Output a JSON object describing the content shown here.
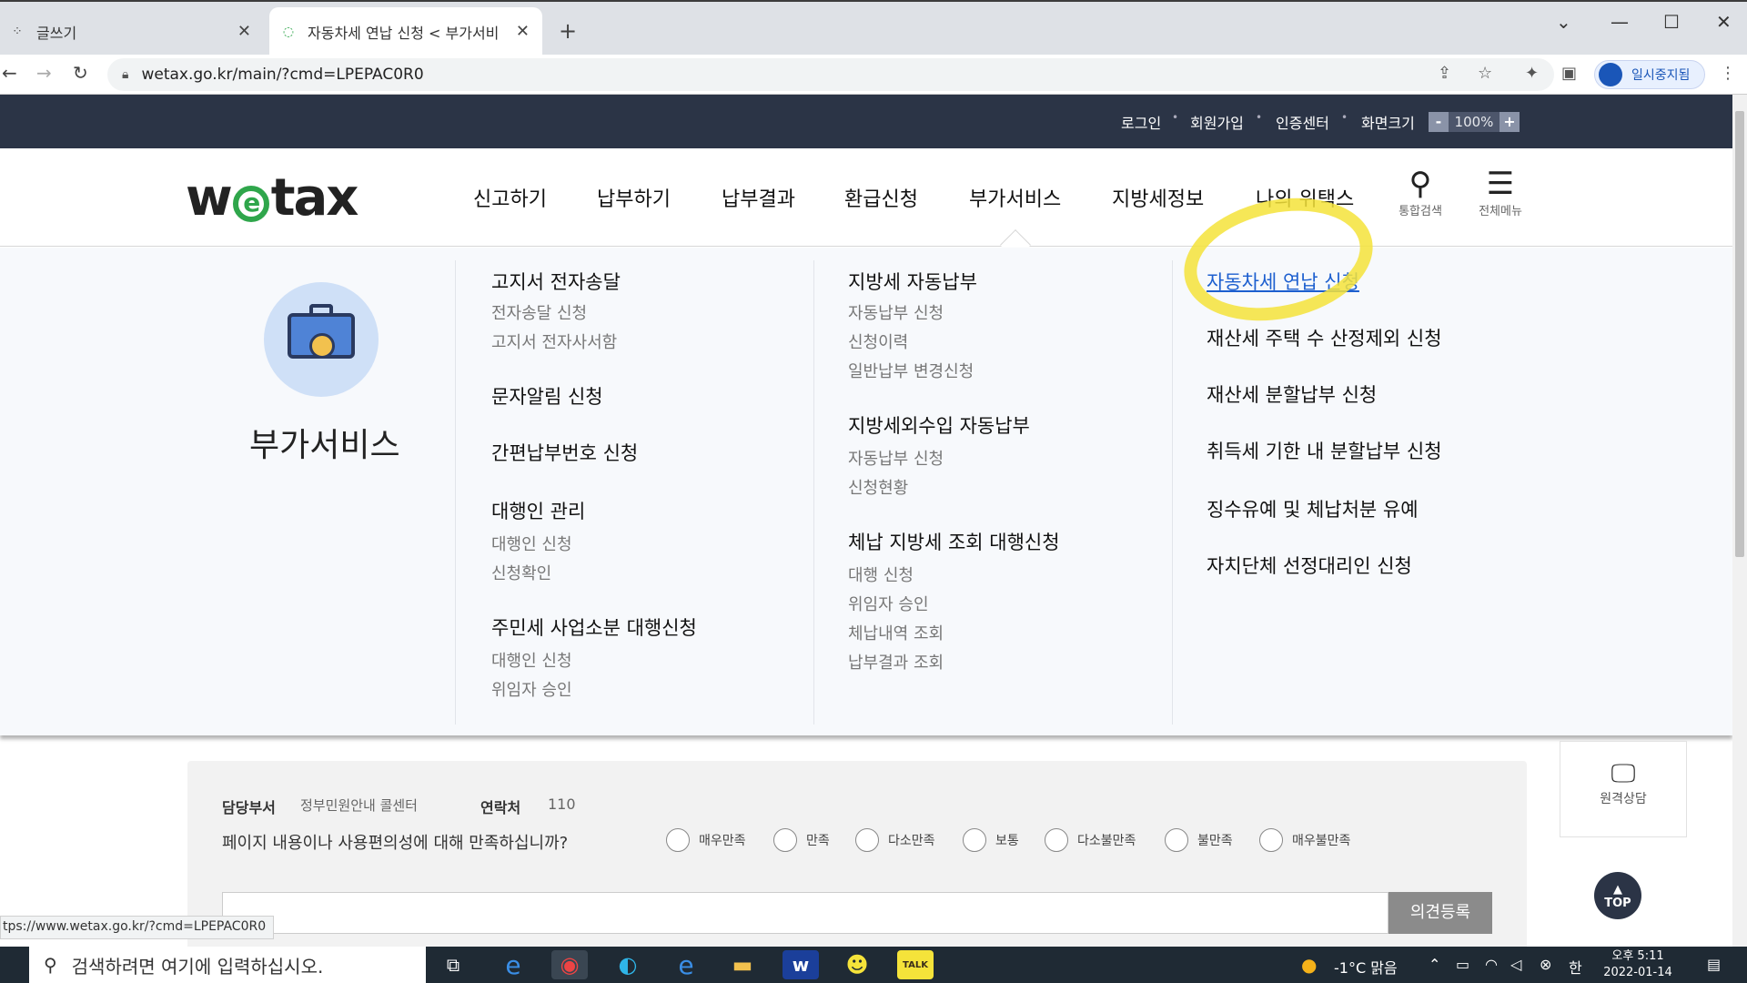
{
  "browser": {
    "tabs": [
      {
        "title": "글쓰기",
        "active": false
      },
      {
        "title": "자동차세 연납 신청 < 부가서비",
        "active": true
      }
    ],
    "url": "wetax.go.kr/main/?cmd=LPEPAC0R0",
    "profile_label": "일시중지됨",
    "status_url": "tps://www.wetax.go.kr/?cmd=LPEPAC0R0"
  },
  "util": {
    "login": "로그인",
    "join": "회원가입",
    "cert": "인증센터",
    "screen": "화면크기",
    "zoom_minus": "-",
    "zoom_value": "100%",
    "zoom_plus": "+"
  },
  "header": {
    "logo": "wetax",
    "gnb": [
      "신고하기",
      "납부하기",
      "납부결과",
      "환급신청",
      "부가서비스",
      "지방세정보",
      "나의 위택스"
    ],
    "search_label": "통합검색",
    "menu_label": "전체메뉴"
  },
  "mega": {
    "side_title": "부가서비스",
    "col1": {
      "g1_title": "고지서 전자송달",
      "g1_items": [
        "전자송달 신청",
        "고지서 전자사서함"
      ],
      "g2_title": "문자알림 신청",
      "g3_title": "간편납부번호 신청",
      "g4_title": "대행인 관리",
      "g4_items": [
        "대행인 신청",
        "신청확인"
      ],
      "g5_title": "주민세 사업소분 대행신청",
      "g5_items": [
        "대행인 신청",
        "위임자 승인"
      ]
    },
    "col2": {
      "g1_title": "지방세 자동납부",
      "g1_items": [
        "자동납부 신청",
        "신청이력",
        "일반납부 변경신청"
      ],
      "g2_title": "지방세외수입 자동납부",
      "g2_items": [
        "자동납부 신청",
        "신청현황"
      ],
      "g3_title": "체납 지방세 조회 대행신청",
      "g3_items": [
        "대행 신청",
        "위임자 승인",
        "체납내역 조회",
        "납부결과 조회"
      ]
    },
    "col3": [
      "자동차세 연납 신청",
      "재산세 주택 수 산정제외 신청",
      "재산세 분할납부 신청",
      "취득세 기한 내 분할납부 신청",
      "징수유예 및 체납처분 유예",
      "자치단체 선정대리인 신청"
    ]
  },
  "feedback": {
    "dept_label": "담당부서",
    "dept_value": "정부민원안내 콜센터",
    "contact_label": "연락처",
    "contact_value": "110",
    "question": "페이지 내용이나 사용편의성에 대해 만족하십니까?",
    "options": [
      "매우만족",
      "만족",
      "다소만족",
      "보통",
      "다소불만족",
      "불만족",
      "매우불만족"
    ],
    "submit": "의견등록"
  },
  "side_widgets": {
    "remote": "원격상담",
    "top": "TOP"
  },
  "taskbar": {
    "search_placeholder": "검색하려면 여기에 입력하십시오.",
    "weather": "-1°C  맑음",
    "ime": "한",
    "time": "오후 5:11",
    "date": "2022-01-14"
  },
  "colors": {
    "util_bg": "#2b3446",
    "link": "#1d5fcf",
    "highlight": "#f5e33a",
    "logo_e": "#2fa64b"
  }
}
